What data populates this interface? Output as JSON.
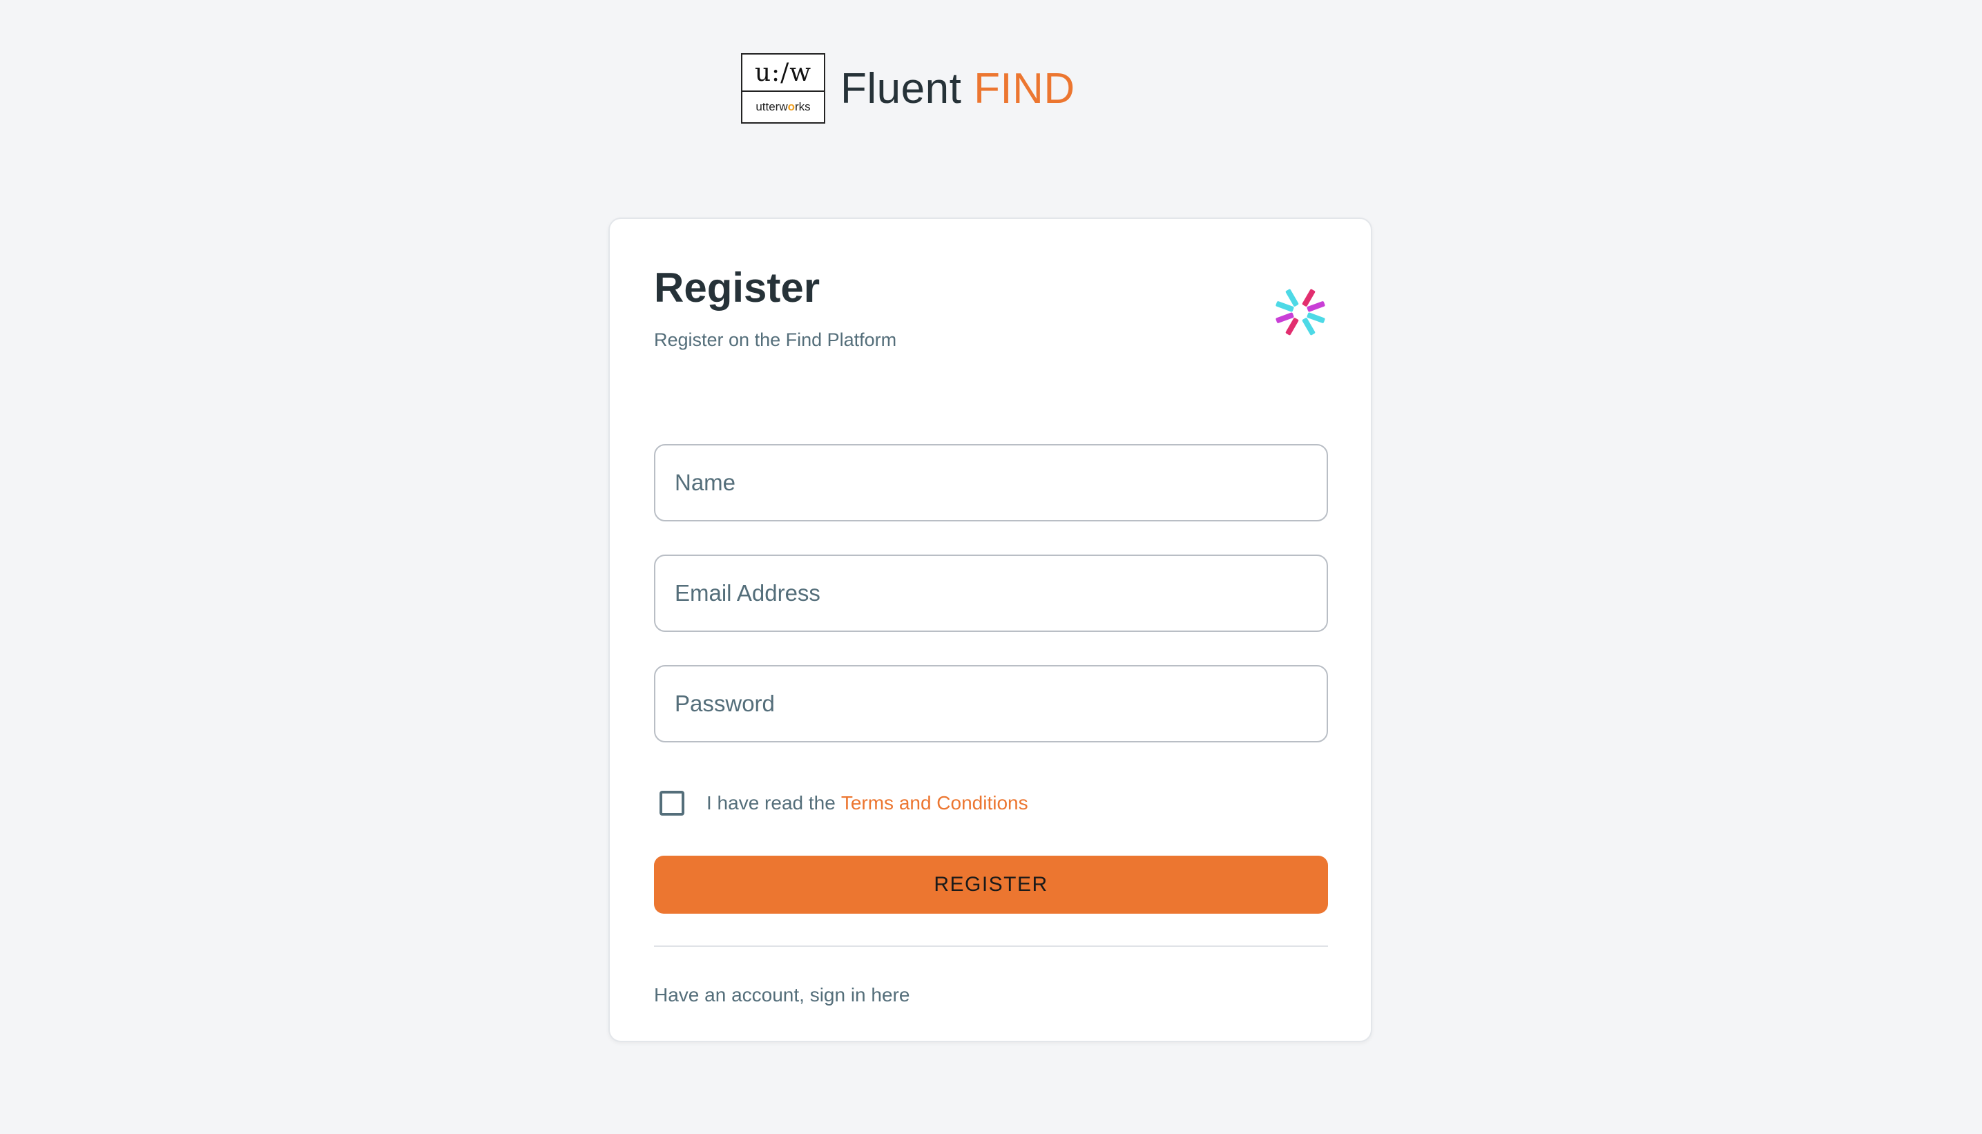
{
  "brand": {
    "logo_top": "u:/w",
    "logo_bottom_before": "utterw",
    "logo_bottom_dot": "o",
    "logo_bottom_after": "rks",
    "name_prefix": "Fluent",
    "name_accent": "FIND"
  },
  "card": {
    "title": "Register",
    "subtitle": "Register on the Find Platform",
    "icon": "spark-logo-icon"
  },
  "form": {
    "name_placeholder": "Name",
    "email_placeholder": "Email Address",
    "password_placeholder": "Password",
    "terms_prefix": "I have read the",
    "terms_link": "Terms and Conditions",
    "terms_checked": false,
    "register_label": "REGISTER",
    "signin_text": "Have an account, sign in here"
  },
  "colors": {
    "accent": "#ec7630",
    "background": "#f4f5f7",
    "text_primary": "#263238",
    "text_secondary": "#546e7a",
    "spark_cyan": "#4dd9e6",
    "spark_magenta": "#c93fd6",
    "spark_pink": "#e22e6f"
  }
}
